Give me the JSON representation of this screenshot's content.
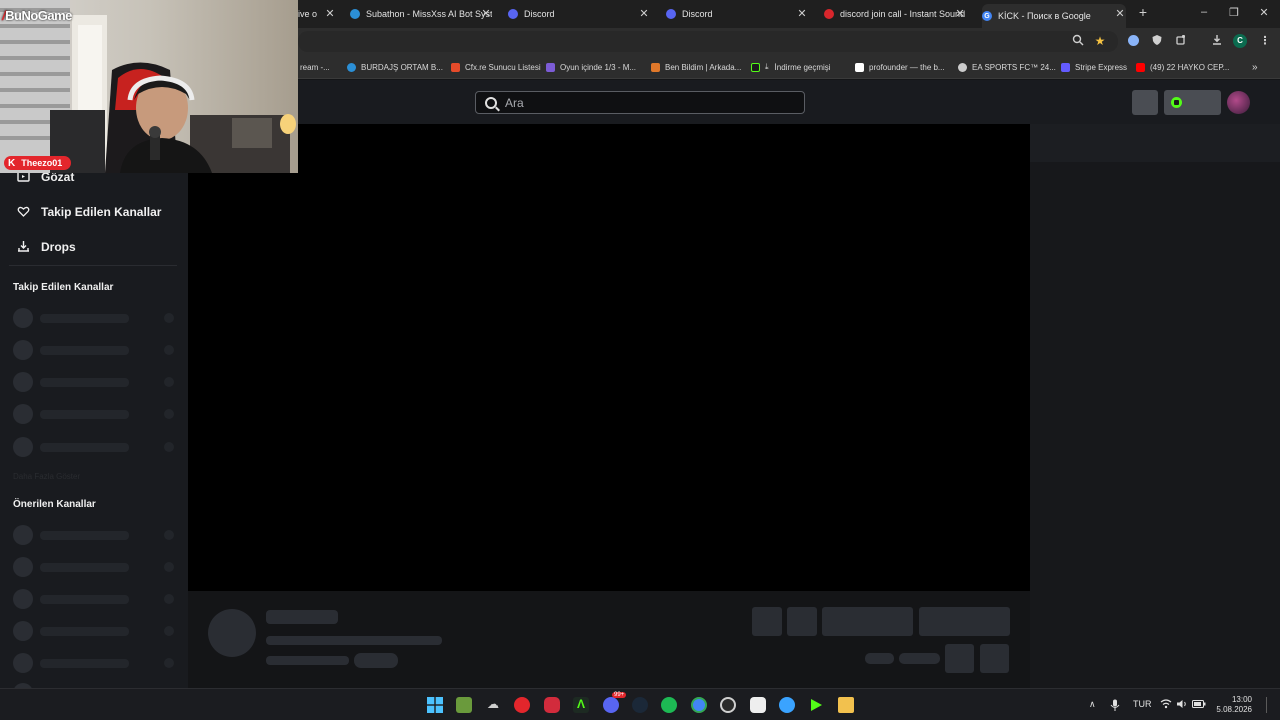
{
  "browser": {
    "tabs": [
      {
        "title": "ive o",
        "favicon_color": "#e86b2a"
      },
      {
        "title": "Subathon - MissXss AI Bot Syst",
        "favicon_color": "#2b8fd6"
      },
      {
        "title": "Discord",
        "favicon_color": "#5865f2"
      },
      {
        "title": "Discord",
        "favicon_color": "#5865f2"
      },
      {
        "title": "discord join call - Instant Sound",
        "favicon_color": "#d8262c"
      },
      {
        "title": "KİCK - Поиск в Google",
        "favicon_color": "#4285f4"
      }
    ],
    "new_tab": "+",
    "window_controls": {
      "minimize": "–",
      "restore": "❐",
      "close": "✕"
    },
    "profile_initial": "C",
    "bookmarks": [
      {
        "label": "ream -...",
        "color": "#888888"
      },
      {
        "label": "BURDAJŞ ORTAM B...",
        "color": "#2b8fd6"
      },
      {
        "label": "Cfx.re Sunucu Listesi",
        "color": "#e64b2a"
      },
      {
        "label": "Oyun içinde 1/3 - M...",
        "color": "#7c5cd6"
      },
      {
        "label": "Ben Bildim | Arkada...",
        "color": "#e0782a"
      },
      {
        "label": "İndirme geçmişi",
        "color": "#53fc18"
      },
      {
        "label": "profounder — the b...",
        "color": "#ffffff"
      },
      {
        "label": "EA SPORTS FC™ 24...",
        "color": "#cccccc"
      },
      {
        "label": "Stripe Express",
        "color": "#635bff"
      },
      {
        "label": "(49) 22 HAYKO CEP...",
        "color": "#ff0000"
      }
    ],
    "bookmarks_more": "»"
  },
  "webcam": {
    "brand": "BuNoGame",
    "streamer_name": "Theezo01",
    "badge_letter": "K",
    "badge_color": "#e3262c"
  },
  "kick": {
    "search_placeholder": "Ara",
    "nav": [
      {
        "label": "Gözat",
        "icon": "browse-icon"
      },
      {
        "label": "Takip Edilen Kanallar",
        "icon": "heart-icon"
      },
      {
        "label": "Drops",
        "icon": "drops-icon"
      }
    ],
    "followed_heading": "Takip Edilen Kanallar",
    "faint_text": "Daha Fazla Göster",
    "recommended_heading": "Önerilen Kanallar",
    "accent_color": "#53fc18"
  },
  "taskbar": {
    "language": "TUR",
    "time": "13:00",
    "date": "5.08.2026",
    "discord_badge": "99+",
    "tray_chevron": "∧"
  }
}
